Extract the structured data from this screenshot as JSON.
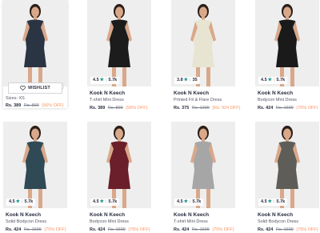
{
  "wishlist_label": "WISHLIST",
  "colors": {
    "star": "#14958f",
    "discount": "#ff905a"
  },
  "products": [
    {
      "brand": "",
      "name": "",
      "sizes_label": "Sizes:",
      "sizes": "XS",
      "price": "Rs. 389",
      "mrp": "Rs. 899",
      "discount": "(56% OFF)",
      "hovered": true,
      "dress_color": "#2b3442"
    },
    {
      "brand": "Kook N Keech",
      "name": "T-shirt Mini Dress",
      "rating": "4.5",
      "reviews": "5.7k",
      "price": "Rs. 389",
      "mrp": "Rs. 899",
      "discount": "(56% OFF)",
      "dress_color": "#1c1c1c"
    },
    {
      "brand": "Kook N Keech",
      "name": "Printed Fit & Flare Dress",
      "rating": "3.8",
      "reviews": "35",
      "price": "Rs. 375",
      "mrp": "Rs. 1299",
      "discount": "(Rs. 924 OFF)",
      "dress_color": "#e8e4d2"
    },
    {
      "brand": "Kook N Keech",
      "name": "Bodycon Mini Dress",
      "rating": "4.5",
      "reviews": "5.7k",
      "price": "Rs. 424",
      "mrp": "Rs. 1699",
      "discount": "(75% OFF)",
      "dress_color": "#1a1a1a"
    },
    {
      "brand": "Kook N Keech",
      "name": "Solid Bodycon Dress",
      "rating": "4.5",
      "reviews": "5.7k",
      "price": "Rs. 424",
      "mrp": "Rs. 1699",
      "discount": "(75% OFF)",
      "dress_color": "#2f4a55"
    },
    {
      "brand": "Kook N Keech",
      "name": "Bodycon Mini Dress",
      "rating": "4.5",
      "reviews": "5.7k",
      "price": "Rs. 424",
      "mrp": "Rs. 1699",
      "discount": "(75% OFF)",
      "dress_color": "#6b1f2a"
    },
    {
      "brand": "Kook N Keech",
      "name": "T-shirt Mini Dress",
      "rating": "4.5",
      "reviews": "5.7k",
      "price": "Rs. 424",
      "mrp": "Rs. 1699",
      "discount": "(75% OFF)",
      "dress_color": "#a6a6a6"
    },
    {
      "brand": "Kook N Keech",
      "name": "Solid Bodycon Dress",
      "rating": "4.5",
      "reviews": "5.7k",
      "price": "Rs. 424",
      "mrp": "Rs. 1699",
      "discount": "(75% OFF)",
      "dress_color": "#5e5d58"
    }
  ]
}
